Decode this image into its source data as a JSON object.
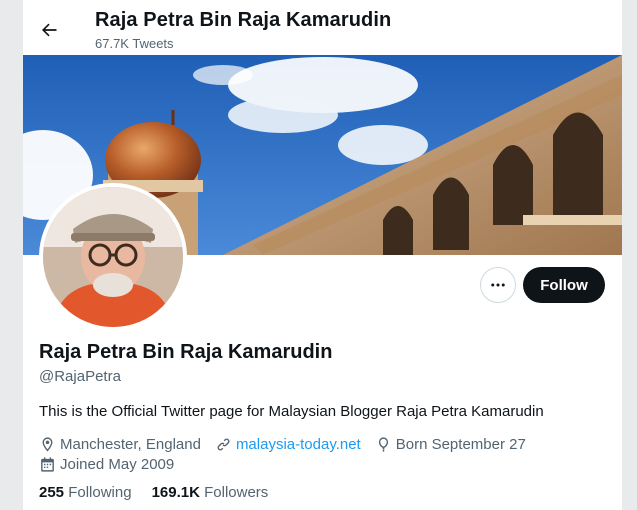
{
  "header": {
    "title": "Raja Petra Bin Raja Kamarudin",
    "tweet_count": "67.7K Tweets"
  },
  "actions": {
    "follow_label": "Follow"
  },
  "profile": {
    "name": "Raja Petra Bin Raja Kamarudin",
    "handle": "@RajaPetra",
    "bio": "This is the Official Twitter page for Malaysian Blogger Raja Petra Kamarudin",
    "location": "Manchester, England",
    "website": "malaysia-today.net",
    "born": "Born September 27",
    "joined": "Joined May 2009"
  },
  "stats": {
    "following_count": "255",
    "following_label": "Following",
    "followers_count": "169.1K",
    "followers_label": "Followers"
  },
  "colors": {
    "accent": "#1d9bf0",
    "text_primary": "#0f1419",
    "text_secondary": "#536471"
  }
}
